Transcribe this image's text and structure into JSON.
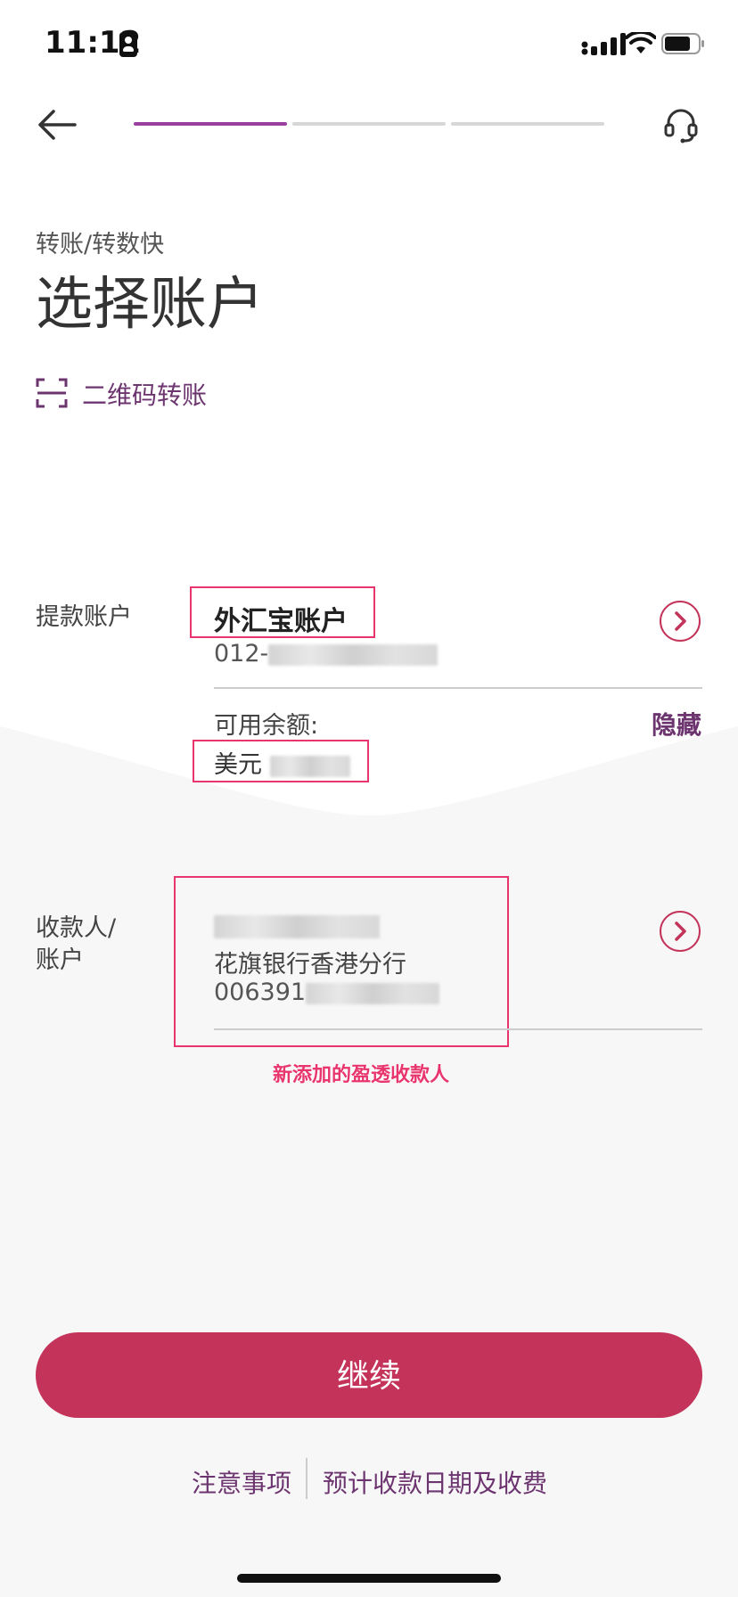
{
  "status_bar": {
    "time": "11:12"
  },
  "nav": {
    "progress_active_step": 1,
    "progress_total_steps": 3
  },
  "header": {
    "subtitle": "转账/转数快",
    "title": "选择账户",
    "qr_link": "二维码转账"
  },
  "debit": {
    "label": "提款账户",
    "account_name": "外汇宝账户",
    "account_number_prefix": "012-",
    "balance_label": "可用余额:",
    "hide_label": "隐藏",
    "currency": "美元"
  },
  "payee": {
    "label_line1": "收款人/",
    "label_line2": "账户",
    "bank": "花旗银行香港分行",
    "account_number_prefix": "006391",
    "annotation": "新添加的盈透收款人"
  },
  "actions": {
    "continue_label": "继续",
    "notes_link": "注意事项",
    "estimate_link": "预计收款日期及收费"
  },
  "colors": {
    "brand_red": "#c4335a",
    "brand_purple": "#9b3f9e",
    "link_purple": "#6d3570",
    "annotation_pink": "#e8356d",
    "bg_grey": "#f7f7f7"
  }
}
